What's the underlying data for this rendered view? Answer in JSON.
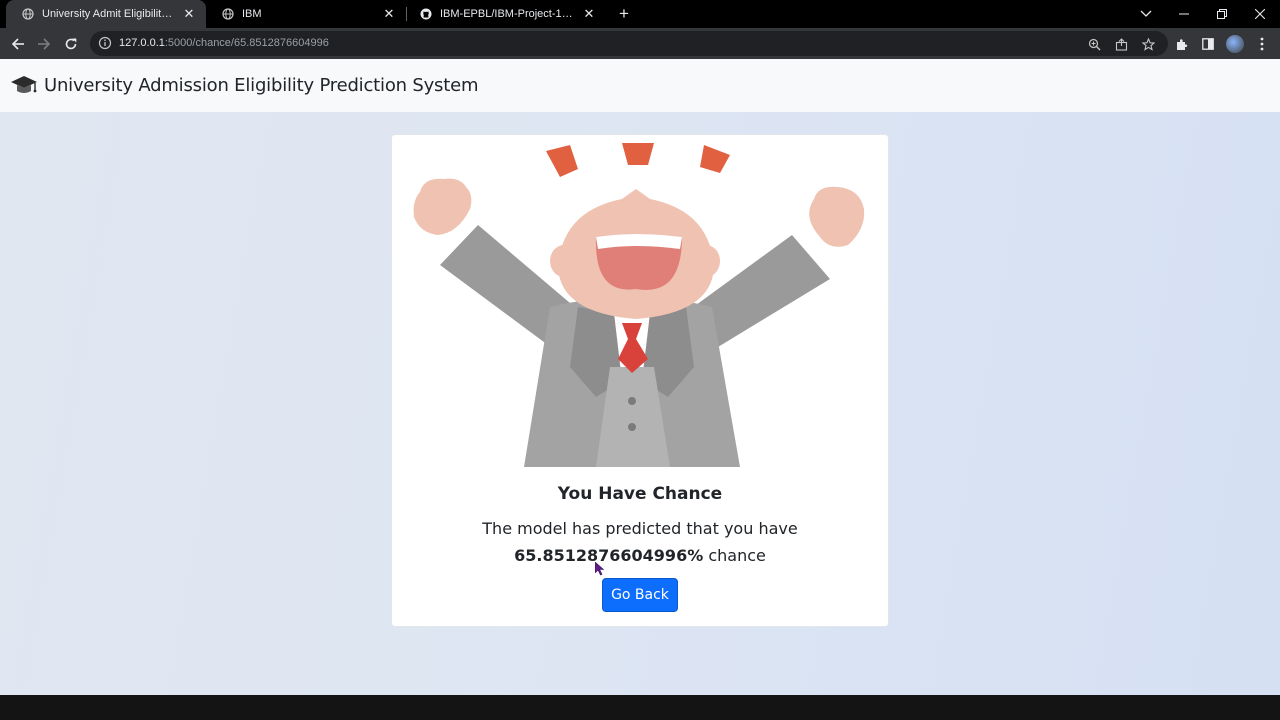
{
  "browser": {
    "tabs": [
      {
        "title": "University Admit Eligibility Predic",
        "active": true
      },
      {
        "title": "IBM",
        "active": false
      },
      {
        "title": "IBM-EPBL/IBM-Project-19316-16",
        "active": false
      }
    ],
    "url": {
      "host": "127.0.0.1",
      "path": ":5000/chance/65.8512876604996"
    }
  },
  "navbar": {
    "brand": "University Admission Eligibility Prediction System",
    "logo_icon": "graduation-cap-icon"
  },
  "result_card": {
    "title": "You Have Chance",
    "text_prefix": "The model has predicted that you have",
    "chance_value": "65.8512876604996%",
    "text_suffix": "chance",
    "button_label": "Go Back"
  },
  "colors": {
    "primary_button": "#0d6efd",
    "navbar_bg": "#f8f9fa"
  }
}
